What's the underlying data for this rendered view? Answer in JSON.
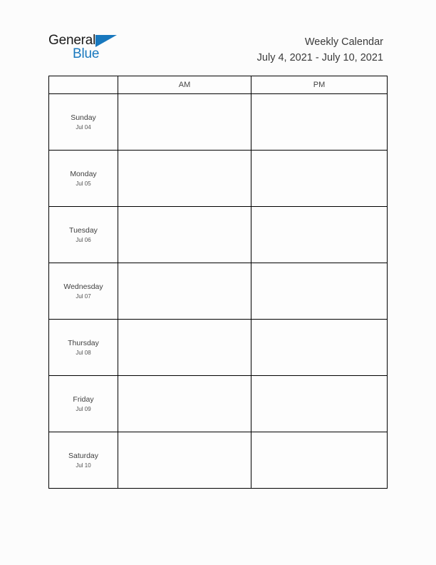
{
  "brand": {
    "name_part1": "General",
    "name_part2": "Blue",
    "triangle_color": "#1878be",
    "part1_color": "#1a1a1a",
    "part2_color": "#1878be"
  },
  "header": {
    "title": "Weekly Calendar",
    "date_range": "July 4, 2021 - July 10, 2021"
  },
  "calendar": {
    "columns": [
      "",
      "AM",
      "PM"
    ],
    "rows": [
      {
        "day": "Sunday",
        "date": "Jul 04",
        "am": "",
        "pm": ""
      },
      {
        "day": "Monday",
        "date": "Jul 05",
        "am": "",
        "pm": ""
      },
      {
        "day": "Tuesday",
        "date": "Jul 06",
        "am": "",
        "pm": ""
      },
      {
        "day": "Wednesday",
        "date": "Jul 07",
        "am": "",
        "pm": ""
      },
      {
        "day": "Thursday",
        "date": "Jul 08",
        "am": "",
        "pm": ""
      },
      {
        "day": "Friday",
        "date": "Jul 09",
        "am": "",
        "pm": ""
      },
      {
        "day": "Saturday",
        "date": "Jul 10",
        "am": "",
        "pm": ""
      }
    ]
  },
  "colors": {
    "page_background": "#fcfcfc",
    "cell_background": "#fdfdfd",
    "border": "#000000",
    "text": "#404040",
    "accent": "#1878be"
  }
}
